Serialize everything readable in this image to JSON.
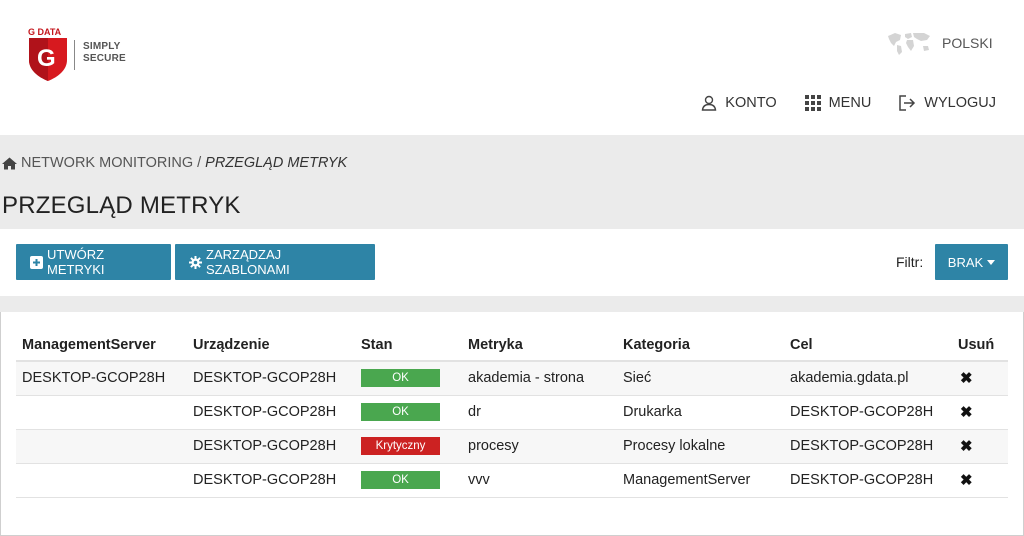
{
  "brand": {
    "logo_text": "G DATA",
    "tagline_line1": "SIMPLY",
    "tagline_line2": "SECURE"
  },
  "language": {
    "label": "POLSKI"
  },
  "nav": {
    "account": "KONTO",
    "menu": "MENU",
    "logout": "WYLOGUJ"
  },
  "breadcrumb": {
    "root": "NETWORK MONITORING",
    "separator": "/",
    "current": "PRZEGLĄD METRYK"
  },
  "page": {
    "title": "PRZEGLĄD METRYK"
  },
  "toolbar": {
    "create_label": "UTWÓRZ METRYKI",
    "manage_label": "ZARZĄDZAJ SZABLONAMI",
    "filter_label": "Filtr:",
    "filter_value": "BRAK"
  },
  "table": {
    "headers": [
      "ManagementServer",
      "Urządzenie",
      "Stan",
      "Metryka",
      "Kategoria",
      "Cel",
      "Usuń"
    ],
    "rows": [
      {
        "server": "DESKTOP-GCOP28H",
        "device": "DESKTOP-GCOP28H",
        "status": "OK",
        "metric": "akademia - strona",
        "category": "Sieć",
        "target": "akademia.gdata.pl"
      },
      {
        "server": "",
        "device": "DESKTOP-GCOP28H",
        "status": "OK",
        "metric": "dr",
        "category": "Drukarka",
        "target": "DESKTOP-GCOP28H"
      },
      {
        "server": "",
        "device": "DESKTOP-GCOP28H",
        "status": "Krytyczny",
        "metric": "procesy",
        "category": "Procesy lokalne",
        "target": "DESKTOP-GCOP28H"
      },
      {
        "server": "",
        "device": "DESKTOP-GCOP28H",
        "status": "OK",
        "metric": "vvv",
        "category": "ManagementServer",
        "target": "DESKTOP-GCOP28H"
      }
    ]
  },
  "colors": {
    "accent": "#2e84a6",
    "ok": "#4aa74f",
    "critical": "#cc2222",
    "band": "#ebebeb"
  },
  "icons": {
    "delete": "✖"
  }
}
